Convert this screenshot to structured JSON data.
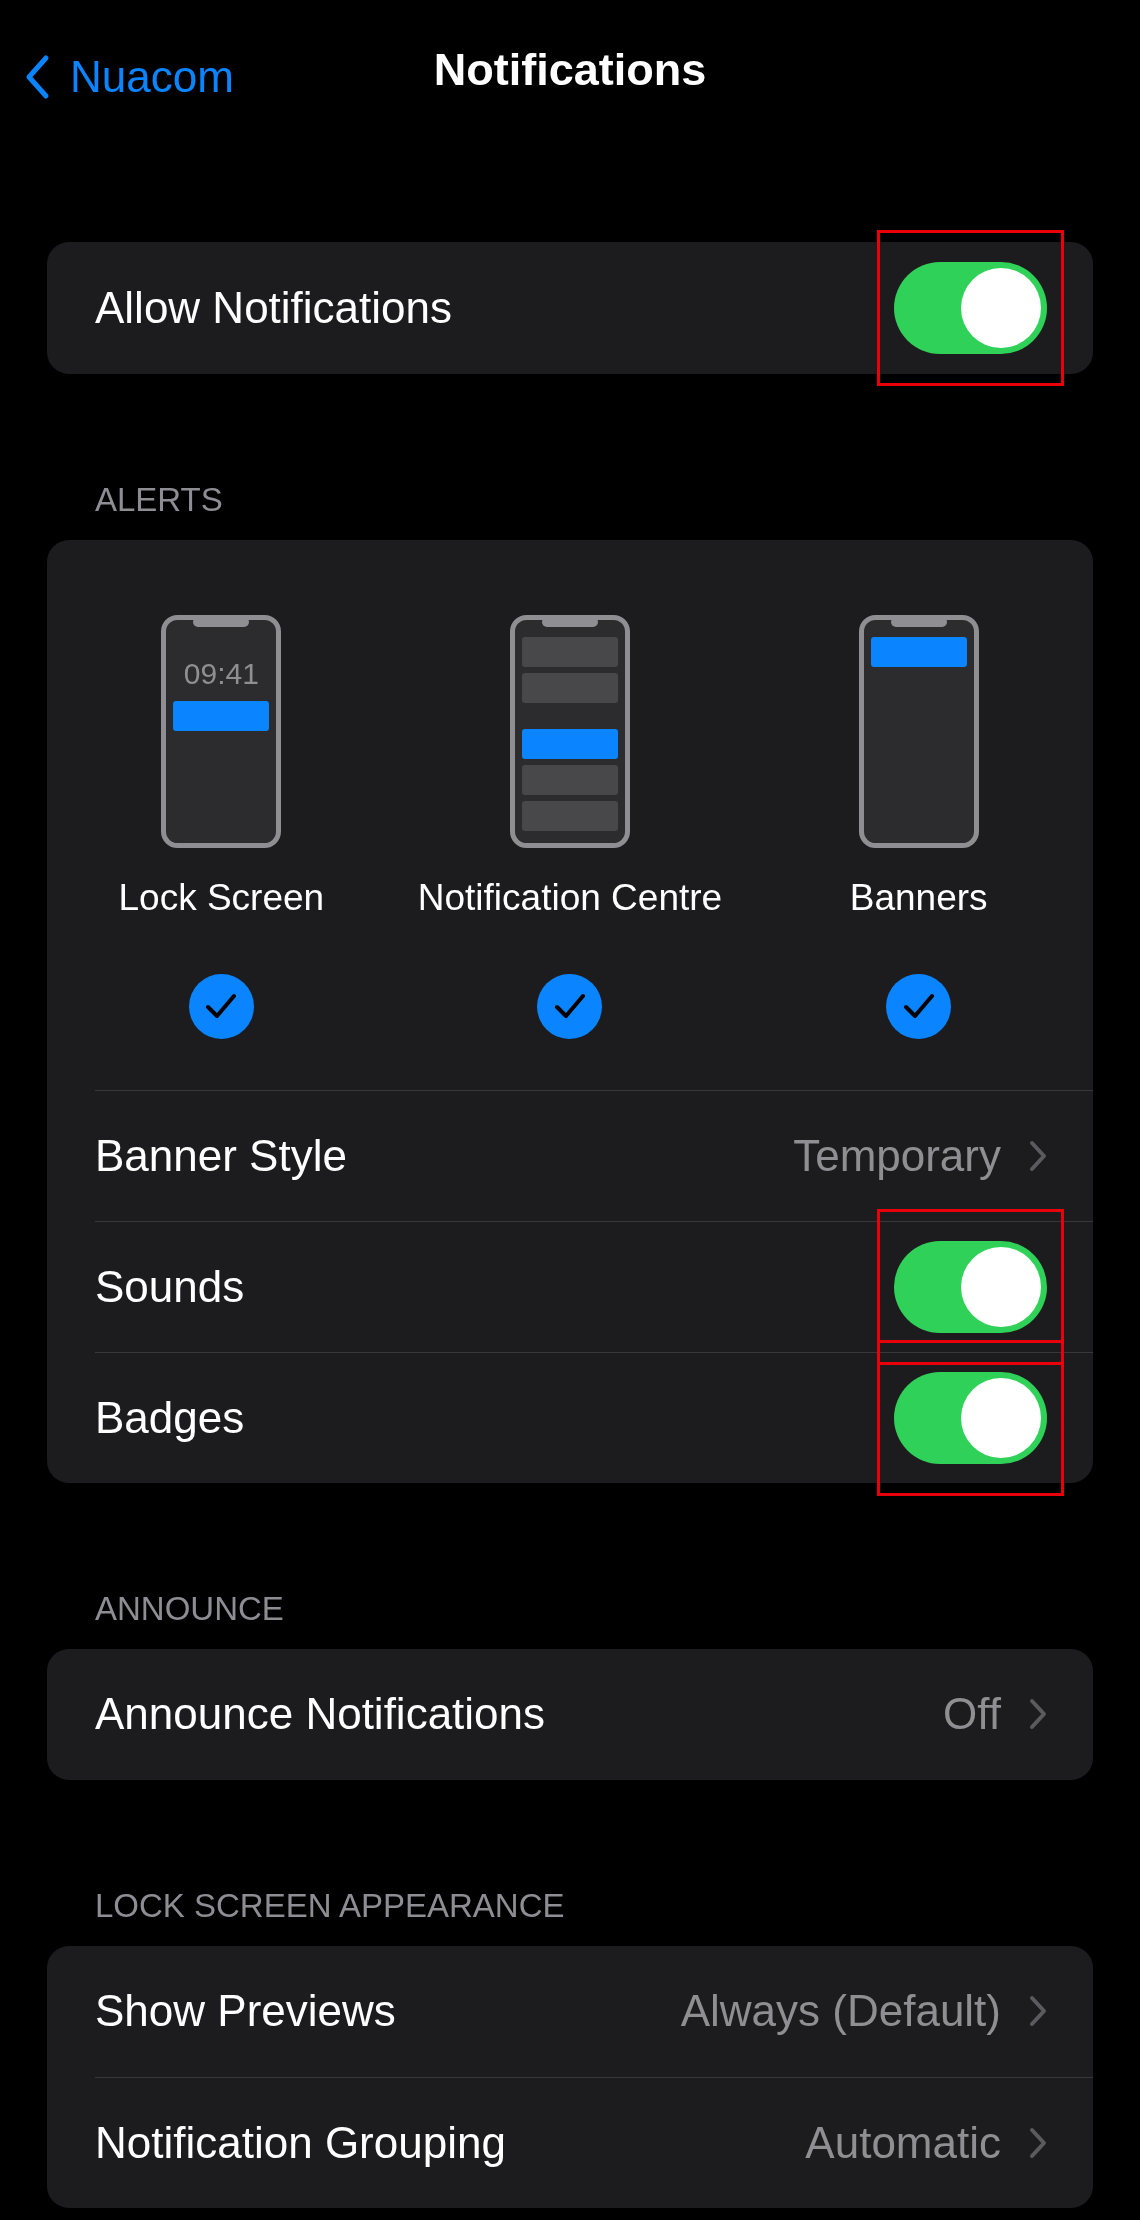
{
  "nav": {
    "back_label": "Nuacom",
    "title": "Notifications"
  },
  "allow": {
    "label": "Allow Notifications",
    "on": true,
    "highlighted": true
  },
  "alerts": {
    "header": "ALERTS",
    "styles": [
      {
        "kind": "lock",
        "label": "Lock Screen",
        "time": "09:41",
        "selected": true
      },
      {
        "kind": "centre",
        "label": "Notification Centre",
        "selected": true
      },
      {
        "kind": "banners",
        "label": "Banners",
        "selected": true
      }
    ],
    "rows": [
      {
        "kind": "link",
        "label": "Banner Style",
        "value": "Temporary"
      },
      {
        "kind": "toggle",
        "label": "Sounds",
        "on": true,
        "highlighted": true
      },
      {
        "kind": "toggle",
        "label": "Badges",
        "on": true,
        "highlighted": true
      }
    ]
  },
  "announce": {
    "header": "ANNOUNCE",
    "rows": [
      {
        "kind": "link",
        "label": "Announce Notifications",
        "value": "Off"
      }
    ]
  },
  "lock_screen_appearance": {
    "header": "LOCK SCREEN APPEARANCE",
    "rows": [
      {
        "kind": "link",
        "label": "Show Previews",
        "value": "Always (Default)"
      },
      {
        "kind": "link",
        "label": "Notification Grouping",
        "value": "Automatic"
      }
    ]
  }
}
